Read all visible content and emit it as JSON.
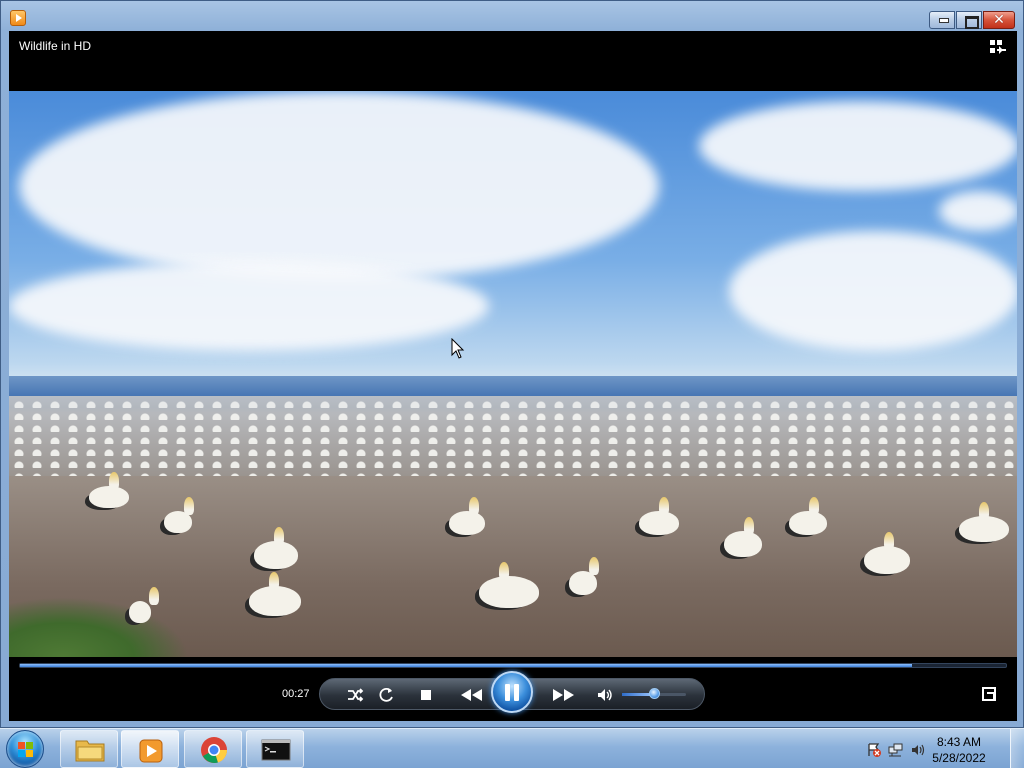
{
  "window": {
    "app_icon": "media-player-icon",
    "controls": {
      "minimize": "minimize-icon",
      "maximize": "maximize-icon",
      "close": "✕"
    }
  },
  "player": {
    "title": "Wildlife in HD",
    "switch_icon": "switch-to-library-icon",
    "elapsed": "00:27",
    "seek_progress": 0.905,
    "volume_level": 0.5,
    "controls": {
      "shuffle": "shuffle-icon",
      "repeat": "repeat-icon",
      "stop": "stop-icon",
      "previous": "previous-icon",
      "pause": "pause-icon",
      "next": "next-icon",
      "mute": "volume-icon",
      "fullscreen": "fullscreen-icon"
    }
  },
  "taskbar": {
    "start": "start-orb",
    "pinned": [
      "file-explorer-icon",
      "media-player-icon",
      "chrome-icon",
      "command-prompt-icon"
    ],
    "tray_icons": [
      "action-center-icon",
      "network-icon",
      "volume-icon"
    ],
    "clock": {
      "time": "8:43 AM",
      "date": "5/28/2022"
    }
  },
  "colors": {
    "accent": "#3c8fdc",
    "close_button": "#c1311a",
    "player_background": "#000000"
  }
}
